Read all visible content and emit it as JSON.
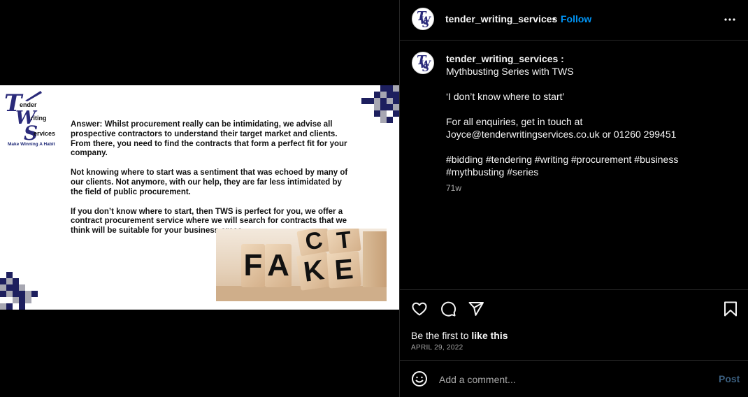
{
  "post": {
    "image": {
      "logo_tagline": "Make Winning A Habit",
      "paragraphs": [
        "Answer: Whilst procurement really can be intimidating, we advise all prospective contractors to understand their target market and clients. From there, you need to find the contracts that form a perfect fit for your company.",
        "Not knowing where to start was a sentiment that was echoed by many of our clients. Not anymore, with our help, they are far less intimidated by the field of public procurement.",
        "If you don’t know where to start, then TWS is perfect for you, we offer a contract procurement service where we will search for contracts that we think will be suitable for your business areas."
      ],
      "dice_letters_front": [
        "F",
        "A",
        "K",
        "E"
      ],
      "dice_letters_top": [
        "C",
        "T"
      ]
    }
  },
  "header": {
    "username": "tender_writing_services",
    "separator": "•",
    "follow_label": "Follow",
    "more_icon": "more-horizontal-icon"
  },
  "caption": {
    "username": "tender_writing_services :",
    "text": "Mythbusting Series with TWS\n\n‘I don’t know where to start’\n\nFor all enquiries, get in touch at\nJoyce@tenderwritingservices.co.uk or 01260 299451\n\n#bidding #tendering #writing #procurement #business\n#mythbusting #series",
    "time": "71w"
  },
  "actions": {
    "icons": [
      "heart-icon",
      "comment-icon",
      "share-icon",
      "bookmark-icon"
    ],
    "likes_prefix": "Be the first to ",
    "likes_bold": "like this",
    "date": "APRIL 29, 2022"
  },
  "comment": {
    "placeholder": "Add a comment...",
    "post_label": "Post",
    "emoji_icon": "emoji-icon"
  },
  "colors": {
    "background": "#000000",
    "follow": "#0095f6",
    "secondary_text": "#a8a8a8",
    "brand_navy": "#1d1f5e"
  }
}
